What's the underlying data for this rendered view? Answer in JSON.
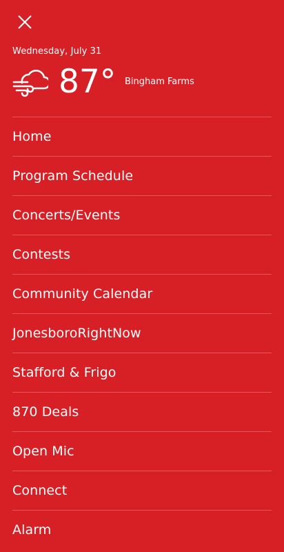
{
  "header": {
    "close_icon": "close-icon",
    "date": "Wednesday, July 31",
    "weather_icon": "wind-cloud-icon",
    "temperature": "87°",
    "location": "Bingham Farms"
  },
  "menu": {
    "items": [
      {
        "label": "Home"
      },
      {
        "label": "Program Schedule"
      },
      {
        "label": "Concerts/Events"
      },
      {
        "label": "Contests"
      },
      {
        "label": "Community Calendar"
      },
      {
        "label": "JonesboroRightNow"
      },
      {
        "label": "Stafford & Frigo"
      },
      {
        "label": "870 Deals"
      },
      {
        "label": "Open Mic"
      },
      {
        "label": "Connect"
      },
      {
        "label": "Alarm"
      }
    ]
  },
  "colors": {
    "background": "#d71f26",
    "text": "#ffffff"
  }
}
